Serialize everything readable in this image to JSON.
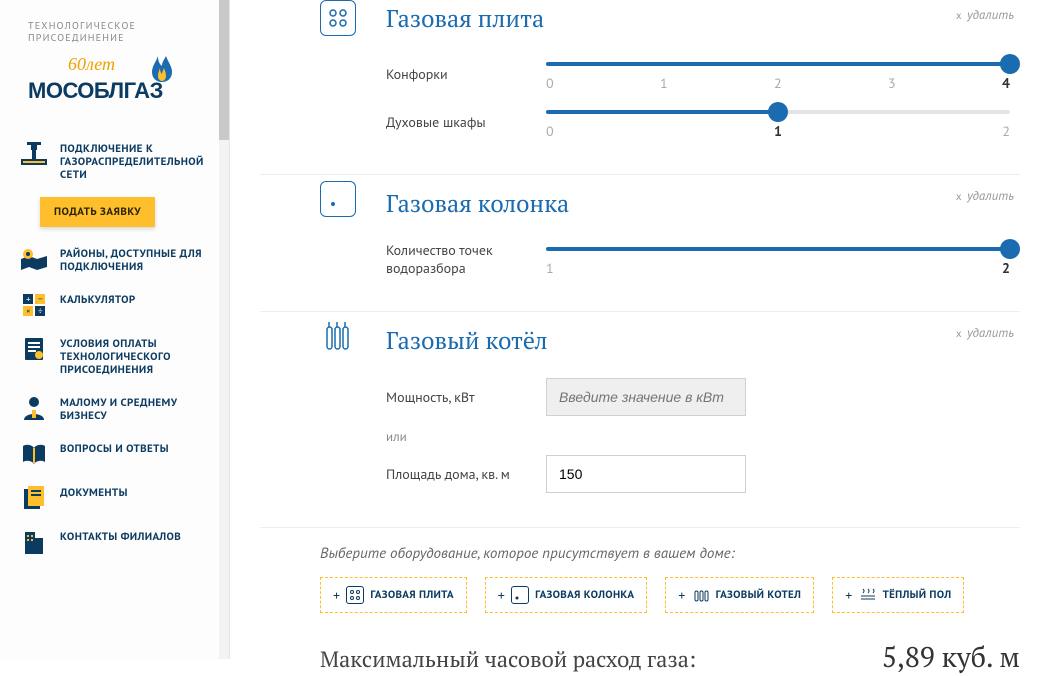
{
  "logo": {
    "tagline1": "ТЕХНОЛОГИЧЕСКОЕ",
    "tagline2": "ПРИСОЕДИНЕНИЕ",
    "brand": "МОСОБЛГАЗ"
  },
  "sidebar": {
    "items": [
      {
        "label": "ПОДКЛЮЧЕНИЕ К ГАЗОРАСПРЕДЕЛИТЕЛЬНОЙ СЕТИ"
      },
      {
        "label": "РАЙОНЫ, ДОСТУПНЫЕ ДЛЯ ПОДКЛЮЧЕНИЯ"
      },
      {
        "label": "КАЛЬКУЛЯТОР"
      },
      {
        "label": "УСЛОВИЯ ОПЛАТЫ ТЕХНОЛОГИЧЕСКОГО ПРИСОЕДИНЕНИЯ"
      },
      {
        "label": "МАЛОМУ И СРЕДНЕМУ БИЗНЕСУ"
      },
      {
        "label": "ВОПРОСЫ И ОТВЕТЫ"
      },
      {
        "label": "ДОКУМЕНТЫ"
      },
      {
        "label": "КОНТАКТЫ ФИЛИАЛОВ"
      }
    ],
    "submit": "ПОДАТЬ ЗАЯВКУ"
  },
  "delete_text": "удалить",
  "equip": {
    "stove": {
      "title": "Газовая плита",
      "burners_label": "Конфорки",
      "burners": {
        "min": 0,
        "max": 4,
        "value": 4,
        "ticks": [
          "0",
          "1",
          "2",
          "3",
          "4"
        ]
      },
      "ovens_label": "Духовые шкафы",
      "ovens": {
        "min": 0,
        "max": 2,
        "value": 1,
        "ticks": [
          "0",
          "1",
          "2"
        ]
      }
    },
    "heater": {
      "title": "Газовая колонка",
      "points_label": "Количество точек водоразбора",
      "points": {
        "min": 1,
        "max": 2,
        "value": 2,
        "ticks": [
          "1",
          "2"
        ]
      }
    },
    "boiler": {
      "title": "Газовый котёл",
      "power_label": "Мощность, кВт",
      "power_placeholder": "Введите значение в кВт",
      "or": "или",
      "area_label": "Площадь дома, кв. м",
      "area_value": "150"
    }
  },
  "select_prompt": "Выберите оборудование, которое присутствует в вашем доме:",
  "chips": [
    {
      "label": "ГАЗОВАЯ ПЛИТА"
    },
    {
      "label": "ГАЗОВАЯ КОЛОНКА"
    },
    {
      "label": "ГАЗОВЫЙ КОТЕЛ"
    },
    {
      "label": "ТЁПЛЫЙ ПОЛ"
    }
  ],
  "result": {
    "label": "Максимальный часовой расход газа:",
    "value": "5,89 куб. м"
  }
}
